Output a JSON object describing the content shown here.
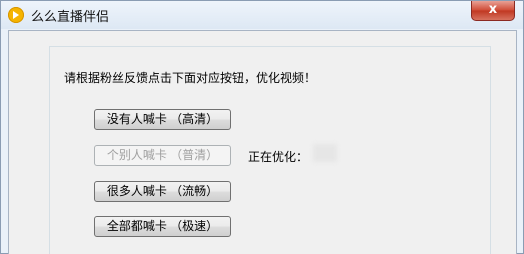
{
  "window": {
    "title": "么么直播伴侣",
    "close_label": "x"
  },
  "prompt": "请根据粉丝反馈点击下面对应按钮，优化视频！",
  "buttons": [
    {
      "label": "没有人喊卡 （高清）",
      "enabled": true
    },
    {
      "label": "个别人喊卡 （普清）",
      "enabled": false
    },
    {
      "label": "很多人喊卡 （流畅）",
      "enabled": true
    },
    {
      "label": "全部都喊卡 （极速）",
      "enabled": true
    }
  ],
  "status": {
    "label": "正在优化："
  }
}
